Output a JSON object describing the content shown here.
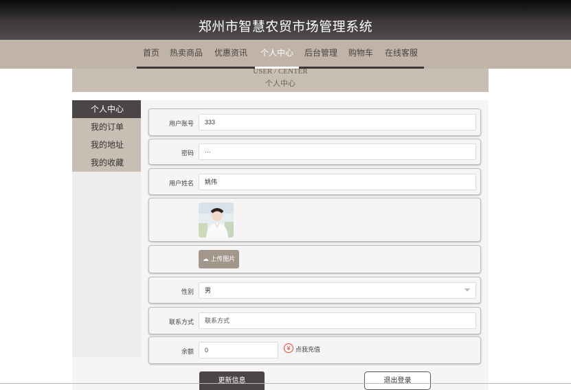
{
  "header": {
    "title": "郑州市智慧农贸市场管理系统"
  },
  "nav": [
    {
      "label": "首页"
    },
    {
      "label": "热卖商品"
    },
    {
      "label": "优惠资讯"
    },
    {
      "label": "个人中心",
      "active": true
    },
    {
      "label": "后台管理"
    },
    {
      "label": "购物车"
    },
    {
      "label": "在线客服"
    }
  ],
  "banner": {
    "en": "USER / CENTER",
    "cn": "个人中心"
  },
  "sidebar": {
    "items": [
      {
        "label": "个人中心",
        "active": true
      },
      {
        "label": "我的订单"
      },
      {
        "label": "我的地址"
      },
      {
        "label": "我的收藏"
      }
    ]
  },
  "form": {
    "account": {
      "label": "用户账号",
      "value": "333"
    },
    "password": {
      "label": "密码",
      "value": "···"
    },
    "name": {
      "label": "用户姓名",
      "value": "姚伟"
    },
    "upload_label": "上传图片",
    "gender": {
      "label": "性别",
      "value": "男"
    },
    "contact": {
      "label": "联系方式",
      "placeholder": "联系方式"
    },
    "balance": {
      "label": "余额",
      "value": "0",
      "recharge": "点我充值",
      "icon": "yuan-coin-icon"
    }
  },
  "buttons": {
    "update": "更新信息",
    "logout": "退出登录"
  },
  "colors": {
    "header_bg": "#3d393a",
    "nav_bg": "#c0b4a8",
    "accent_dark": "#4b4545",
    "upload_bg": "#a3968b"
  }
}
